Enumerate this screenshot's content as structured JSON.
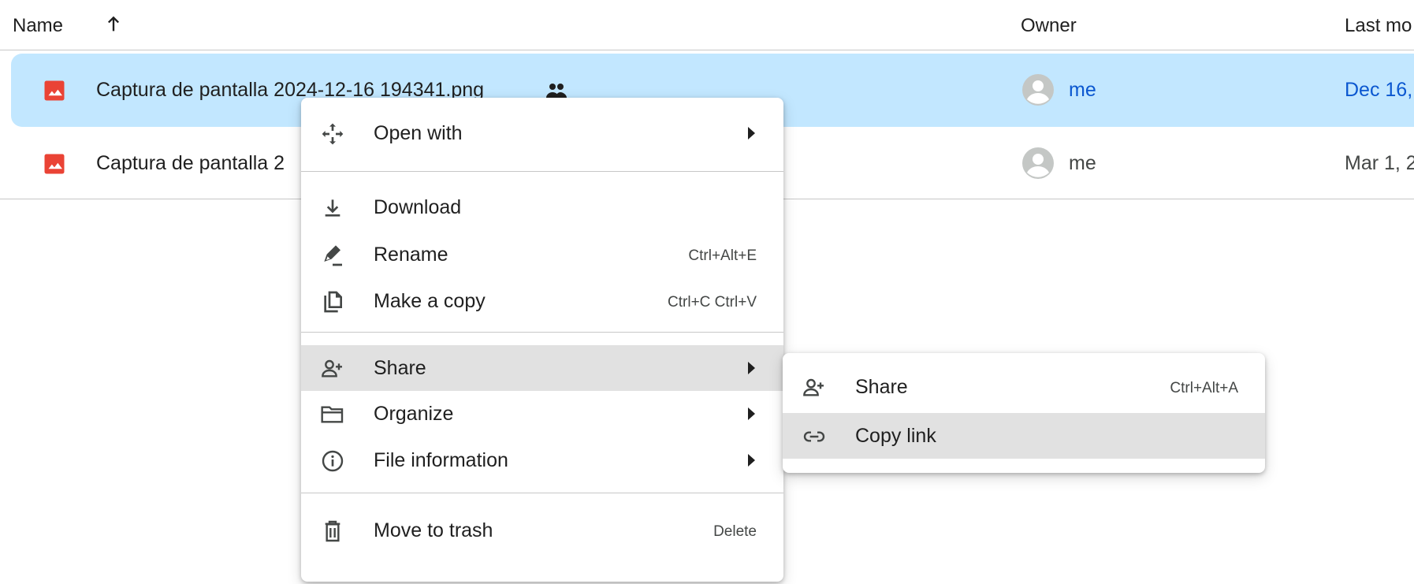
{
  "header": {
    "name": "Name",
    "owner": "Owner",
    "last_modified": "Last mo"
  },
  "files": [
    {
      "name": "Captura de pantalla 2024-12-16 194341.png",
      "owner": "me",
      "modified": "Dec 16,",
      "shared": true,
      "selected": true
    },
    {
      "name": "Captura de pantalla 2",
      "owner": "me",
      "modified": "Mar 1, 2",
      "shared": false,
      "selected": false
    }
  ],
  "context_menu": {
    "open_with": "Open with",
    "download": "Download",
    "rename": "Rename",
    "rename_shortcut": "Ctrl+Alt+E",
    "make_copy": "Make a copy",
    "make_copy_shortcut": "Ctrl+C Ctrl+V",
    "share": "Share",
    "organize": "Organize",
    "file_information": "File information",
    "move_to_trash": "Move to trash",
    "move_to_trash_shortcut": "Delete"
  },
  "share_submenu": {
    "share": "Share",
    "share_shortcut": "Ctrl+Alt+A",
    "copy_link": "Copy link"
  },
  "colors": {
    "selected_row": "#c2e7ff",
    "link_blue": "#0b57d0",
    "image_icon_red": "#ea4335",
    "menu_hover": "#e1e1e1"
  }
}
